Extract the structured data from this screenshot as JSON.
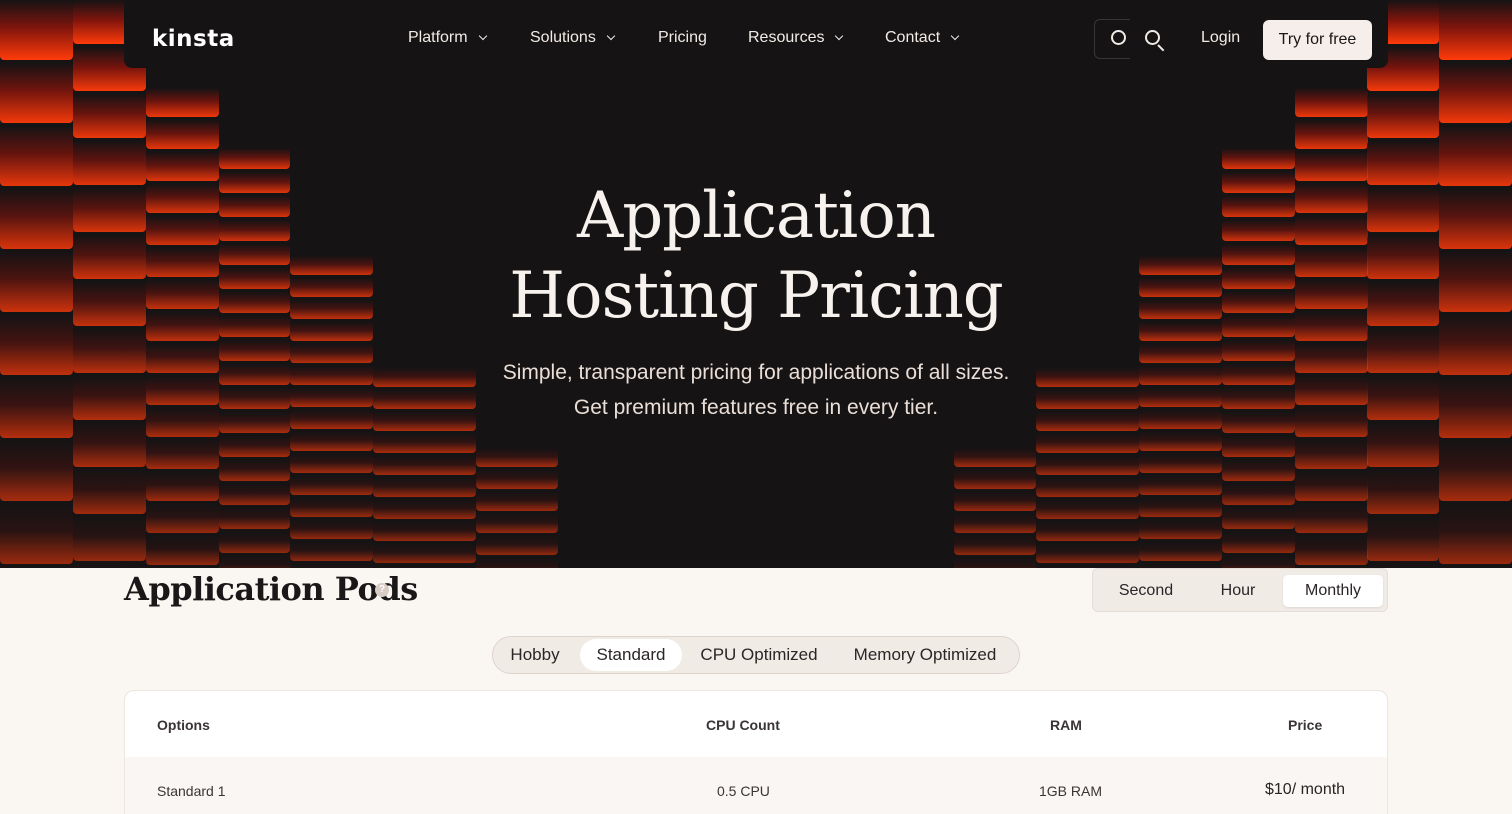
{
  "brand": {
    "logo_text": "kinsta"
  },
  "nav": {
    "items": [
      {
        "label": "Platform",
        "has_dropdown": true
      },
      {
        "label": "Solutions",
        "has_dropdown": true
      },
      {
        "label": "Pricing",
        "has_dropdown": false
      },
      {
        "label": "Resources",
        "has_dropdown": true
      },
      {
        "label": "Contact",
        "has_dropdown": true
      }
    ],
    "login_label": "Login",
    "cta_label": "Try for free"
  },
  "hero": {
    "title_line1": "Application",
    "title_line2": "Hosting Pricing",
    "subtitle_line1": "Simple, transparent pricing for applications of all sizes.",
    "subtitle_line2": "Get premium features free in every tier."
  },
  "pods": {
    "title": "Application Pods",
    "help_icon": "question-icon",
    "periods": [
      "Second",
      "Hour",
      "Monthly"
    ],
    "selected_period": "Monthly",
    "tiers": [
      "Hobby",
      "Standard",
      "CPU Optimized",
      "Memory Optimized"
    ],
    "selected_tier": "Standard",
    "table": {
      "headers": [
        "Options",
        "CPU Count",
        "RAM",
        "Price"
      ],
      "rows": [
        {
          "option": "Standard 1",
          "cpu": "0.5 CPU",
          "ram": "1GB RAM",
          "price": "$10/ month"
        }
      ]
    }
  },
  "colors": {
    "hero_bg": "#161314",
    "accent_red": "#ff3b0a",
    "page_bg": "#faf6f2"
  }
}
